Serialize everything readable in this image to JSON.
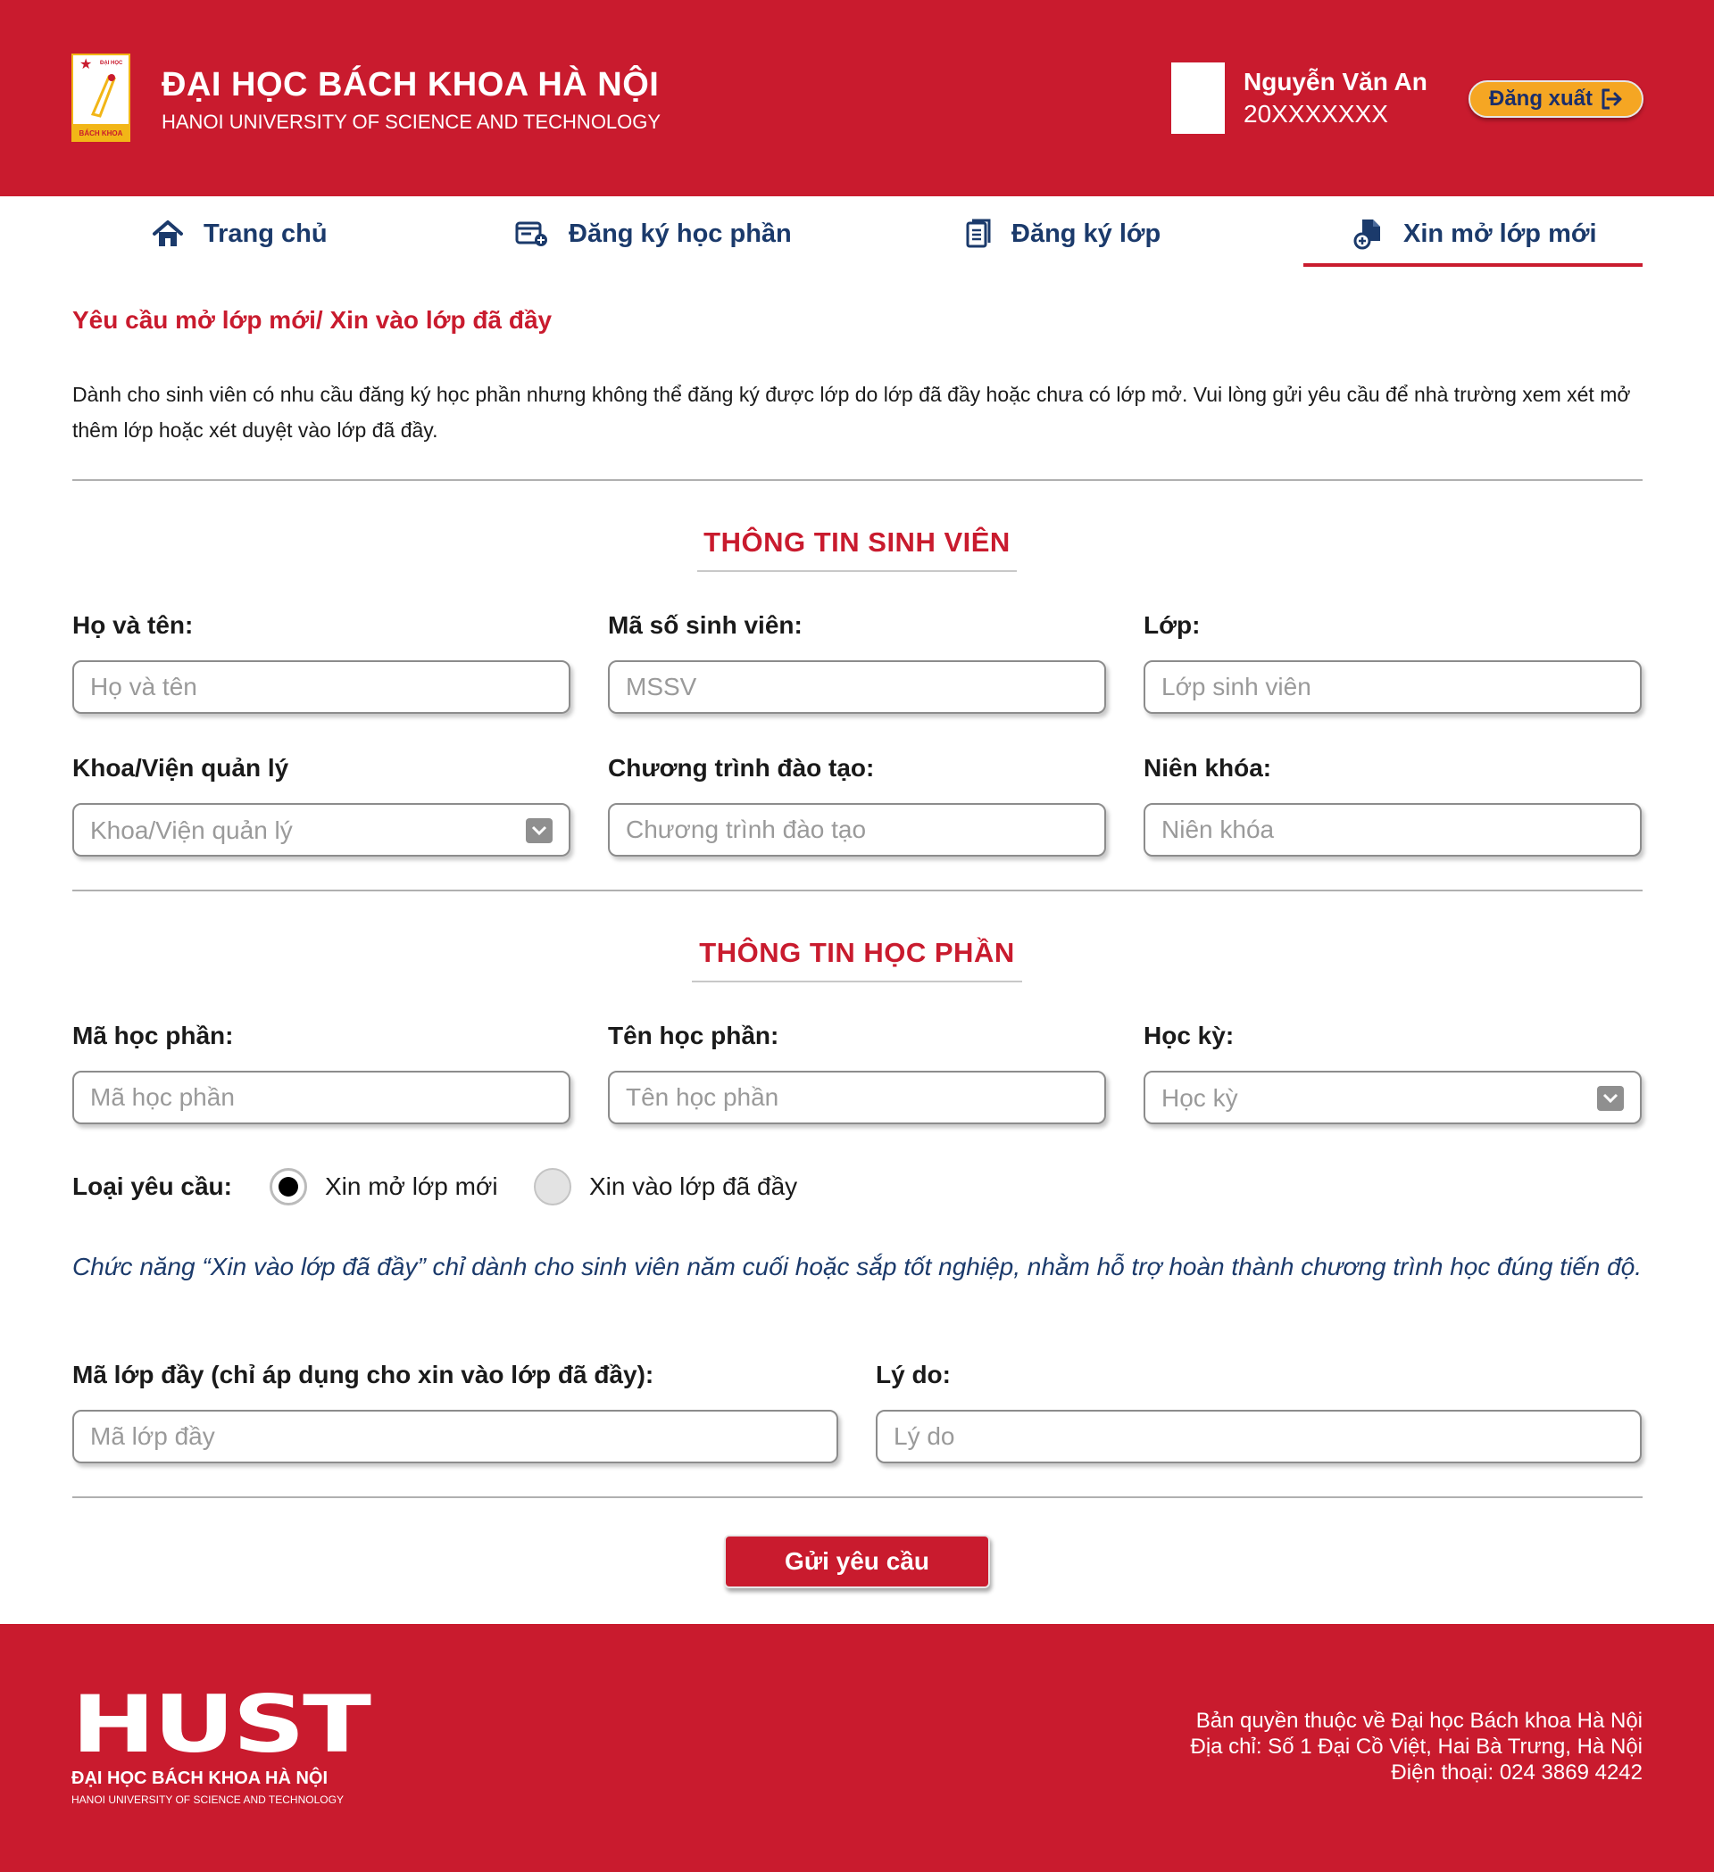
{
  "header": {
    "logo_top": "ĐẠI HỌC",
    "logo_bottom": "BÁCH KHOA",
    "title": "ĐẠI HỌC BÁCH KHOA HÀ NỘI",
    "subtitle": "HANOI UNIVERSITY OF SCIENCE AND TECHNOLOGY",
    "user_name": "Nguyễn Văn An",
    "user_id": "20XXXXXXX",
    "logout_label": "Đăng xuất"
  },
  "nav": {
    "home": "Trang chủ",
    "course_register": "Đăng ký học phần",
    "class_register": "Đăng ký lớp",
    "new_class": "Xin mở lớp mới",
    "active": "new_class"
  },
  "page": {
    "heading": "Yêu cầu mở lớp mới/ Xin vào lớp đã đầy",
    "intro": "Dành cho sinh viên có nhu cầu đăng ký học phần nhưng không thể đăng ký được lớp do lớp đã đầy hoặc chưa có lớp mở. Vui lòng gửi yêu cầu để nhà trường xem xét mở thêm lớp hoặc xét duyệt vào lớp đã đầy."
  },
  "student_section": {
    "title": "THÔNG TIN SINH VIÊN",
    "full_name_label": "Họ và tên:",
    "full_name_placeholder": "Họ và tên",
    "student_id_label": "Mã số sinh viên:",
    "student_id_placeholder": "MSSV",
    "class_label": "Lớp:",
    "class_placeholder": "Lớp sinh viên",
    "faculty_label": "Khoa/Viện quản lý",
    "faculty_placeholder": "Khoa/Viện quản lý",
    "program_label": "Chương trình đào tạo:",
    "program_placeholder": "Chương trình đào tạo",
    "cohort_label": "Niên khóa:",
    "cohort_placeholder": "Niên khóa"
  },
  "course_section": {
    "title": "THÔNG TIN HỌC PHẦN",
    "course_code_label": "Mã học phần:",
    "course_code_placeholder": "Mã học phần",
    "course_name_label": "Tên học phần:",
    "course_name_placeholder": "Tên học phần",
    "semester_label": "Học kỳ:",
    "semester_placeholder": "Học kỳ",
    "request_type_label": "Loại yêu cầu:",
    "option_new": "Xin mở lớp mới",
    "option_full": "Xin vào lớp đã đầy",
    "selected_option": "Xin mở lớp mới",
    "note": "Chức năng “Xin vào lớp đã đầy” chỉ dành cho sinh viên năm cuối hoặc sắp tốt nghiệp, nhằm hỗ trợ hoàn thành chương trình học đúng tiến độ.",
    "full_class_code_label": "Mã lớp đầy (chỉ áp dụng cho xin vào lớp đã đầy):",
    "full_class_code_placeholder": "Mã lớp đầy",
    "reason_label": "Lý do:",
    "reason_placeholder": "Lý do"
  },
  "submit_label": "Gửi yêu cầu",
  "footer": {
    "logo": "HUST",
    "name": "ĐẠI HỌC BÁCH KHOA HÀ NỘI",
    "subname": "HANOI UNIVERSITY OF SCIENCE AND TECHNOLOGY",
    "copyright": "Bản quyền thuộc về Đại học Bách khoa Hà Nội",
    "address": "Địa chỉ: Số 1 Đại Cồ Việt, Hai Bà Trưng, Hà Nội",
    "phone": "Điện thoại: 024 3869 4242"
  },
  "colors": {
    "brand_red": "#c91b2e",
    "nav_blue": "#1b3a6b",
    "logout_orange": "#f5a623"
  },
  "icons": {
    "home": "home-icon",
    "course_register": "register-card-icon",
    "class_register": "document-list-icon",
    "new_class": "file-plus-icon",
    "logout": "logout-icon",
    "dropdown": "chevron-down-icon"
  }
}
